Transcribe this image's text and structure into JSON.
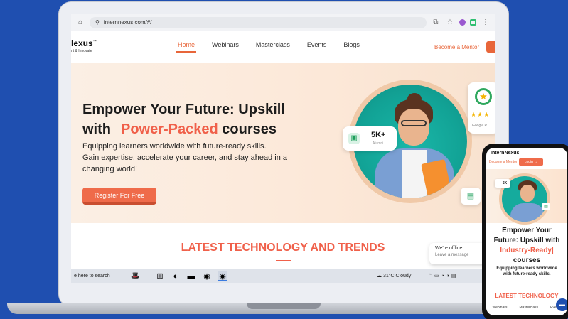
{
  "browser": {
    "url": "internnexus.com/#/"
  },
  "site": {
    "logo_main": "lexus",
    "logo_super": "™",
    "logo_sub": "nt & Innovate",
    "nav": [
      {
        "label": "Home",
        "active": true
      },
      {
        "label": "Webinars",
        "active": false
      },
      {
        "label": "Masterclass",
        "active": false
      },
      {
        "label": "Events",
        "active": false
      },
      {
        "label": "Blogs",
        "active": false
      }
    ],
    "mentor_link": "Become a Mentor"
  },
  "hero": {
    "title_line1": "Empower Your Future: Upskill",
    "title_line2_prefix": "with",
    "title_accent": "Power-Packed",
    "title_line2_suffix": "courses",
    "subtitle_line1": "Equipping learners worldwide with future-ready skills.",
    "subtitle_line2": "Gain expertise, accelerate your career, and stay ahead in a",
    "subtitle_line3": "changing world!",
    "cta": "Register For Free",
    "stat_value": "5K+",
    "stat_label": "Alumni",
    "rating_stars": "★★★",
    "rating_label": "Google R"
  },
  "section": {
    "title": "LATEST TECHNOLOGY AND TRENDS"
  },
  "chat_widget": {
    "status": "We're offline",
    "action": "Leave a message"
  },
  "taskbar": {
    "search_text": "e here to search",
    "weather": "31°C  Cloudy"
  },
  "phone": {
    "logo": "InternNexus",
    "mentor": "Become a Mentor",
    "login": "Login →",
    "stat_value": "5K+",
    "title_line1": "Empower Your",
    "title_line2": "Future: Upskill with",
    "title_accent": "Industry-Ready|",
    "title_line4": "courses",
    "sub_line1": "Equipping learners worldwide",
    "sub_line2": "with future-ready skills.",
    "section": "LATEST TECHNOLOGY",
    "nav": [
      "Webinars",
      "Masterclass",
      "Events"
    ]
  }
}
